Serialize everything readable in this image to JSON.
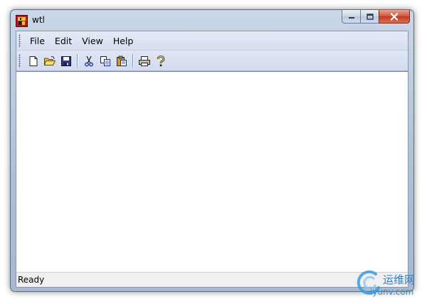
{
  "window": {
    "title": "wtl",
    "app_icon": "wtl-app-icon"
  },
  "caption_buttons": {
    "minimize": "minimize-icon",
    "maximize": "maximize-icon",
    "close": "close-icon"
  },
  "menu": {
    "items": [
      {
        "label": "File"
      },
      {
        "label": "Edit"
      },
      {
        "label": "View"
      },
      {
        "label": "Help"
      }
    ]
  },
  "toolbar": {
    "buttons": [
      {
        "icon": "new-file-icon"
      },
      {
        "icon": "open-folder-icon"
      },
      {
        "icon": "save-disk-icon"
      },
      {
        "icon": "cut-scissors-icon"
      },
      {
        "icon": "copy-icon"
      },
      {
        "icon": "paste-icon"
      },
      {
        "icon": "print-icon"
      },
      {
        "icon": "help-question-icon"
      }
    ]
  },
  "status": {
    "text": "Ready"
  },
  "watermark": {
    "text_cn": "运维网",
    "url": "iyunv.com"
  },
  "colors": {
    "frame": "#aebfd6",
    "menubar": "#d6dff0",
    "close_button": "#c23a1e",
    "view_background": "#ffffff"
  }
}
